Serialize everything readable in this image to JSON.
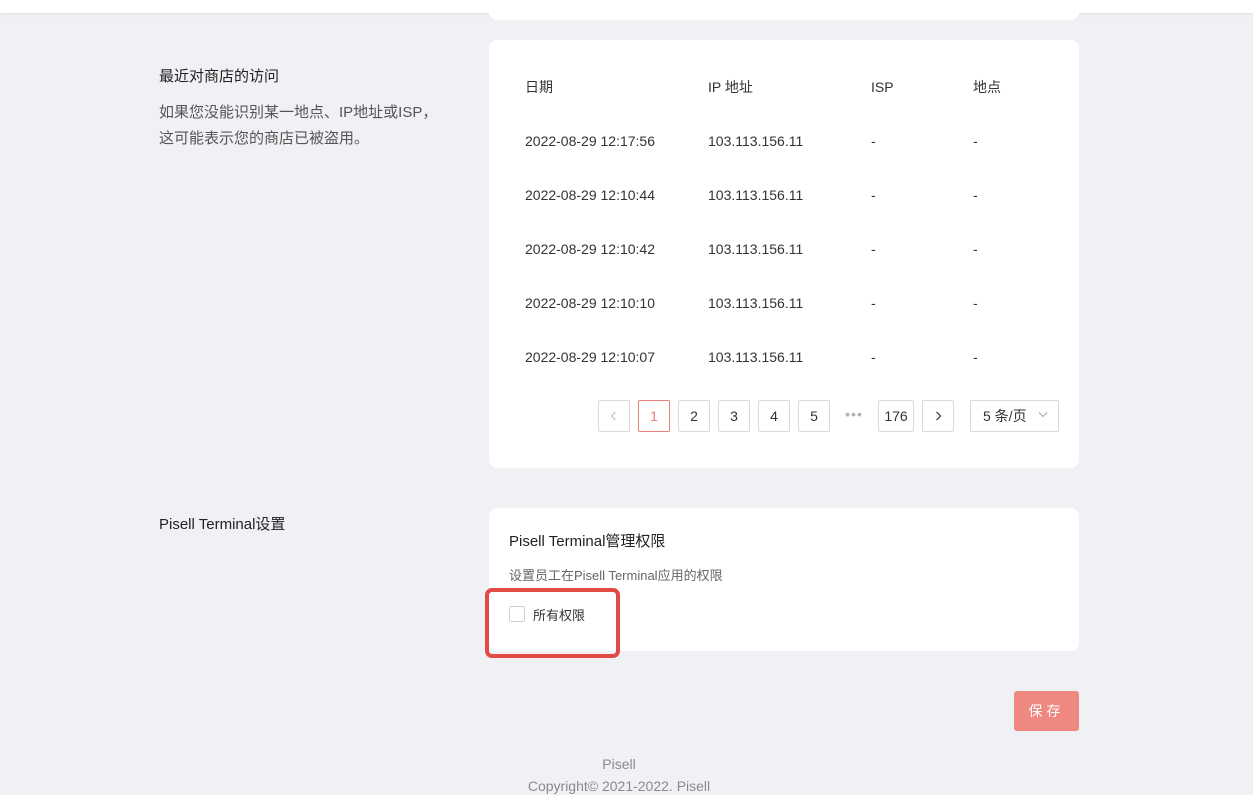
{
  "access_section": {
    "title": "最近对商店的访问",
    "description": "如果您没能识别某一地点、IP地址或ISP，这可能表示您的商店已被盗用。",
    "table": {
      "headers": [
        "日期",
        "IP 地址",
        "ISP",
        "地点"
      ],
      "rows": [
        [
          "2022-08-29 12:17:56",
          "103.113.156.11",
          "-",
          "-"
        ],
        [
          "2022-08-29 12:10:44",
          "103.113.156.11",
          "-",
          "-"
        ],
        [
          "2022-08-29 12:10:42",
          "103.113.156.11",
          "-",
          "-"
        ],
        [
          "2022-08-29 12:10:10",
          "103.113.156.11",
          "-",
          "-"
        ],
        [
          "2022-08-29 12:10:07",
          "103.113.156.11",
          "-",
          "-"
        ]
      ]
    },
    "pagination": {
      "prev_icon": "chevron-left-icon",
      "next_icon": "chevron-right-icon",
      "pages": [
        "1",
        "2",
        "3",
        "4",
        "5"
      ],
      "current": "1",
      "ellipsis": "•••",
      "last_page": "176",
      "page_size": "5 条/页"
    }
  },
  "terminal_section": {
    "title": "Pisell Terminal设置",
    "card_title": "Pisell Terminal管理权限",
    "card_desc": "设置员工在Pisell Terminal应用的权限",
    "checkbox_label": "所有权限",
    "checkbox_checked": false
  },
  "actions": {
    "save_label": "保存"
  },
  "footer": {
    "brand": "Pisell",
    "copyright": "Copyright© 2021-2022. Pisell"
  },
  "colors": {
    "accent": "#e4817a",
    "save_button": "#ef8880",
    "highlight": "#e24a45",
    "background": "#f0f1f4"
  }
}
